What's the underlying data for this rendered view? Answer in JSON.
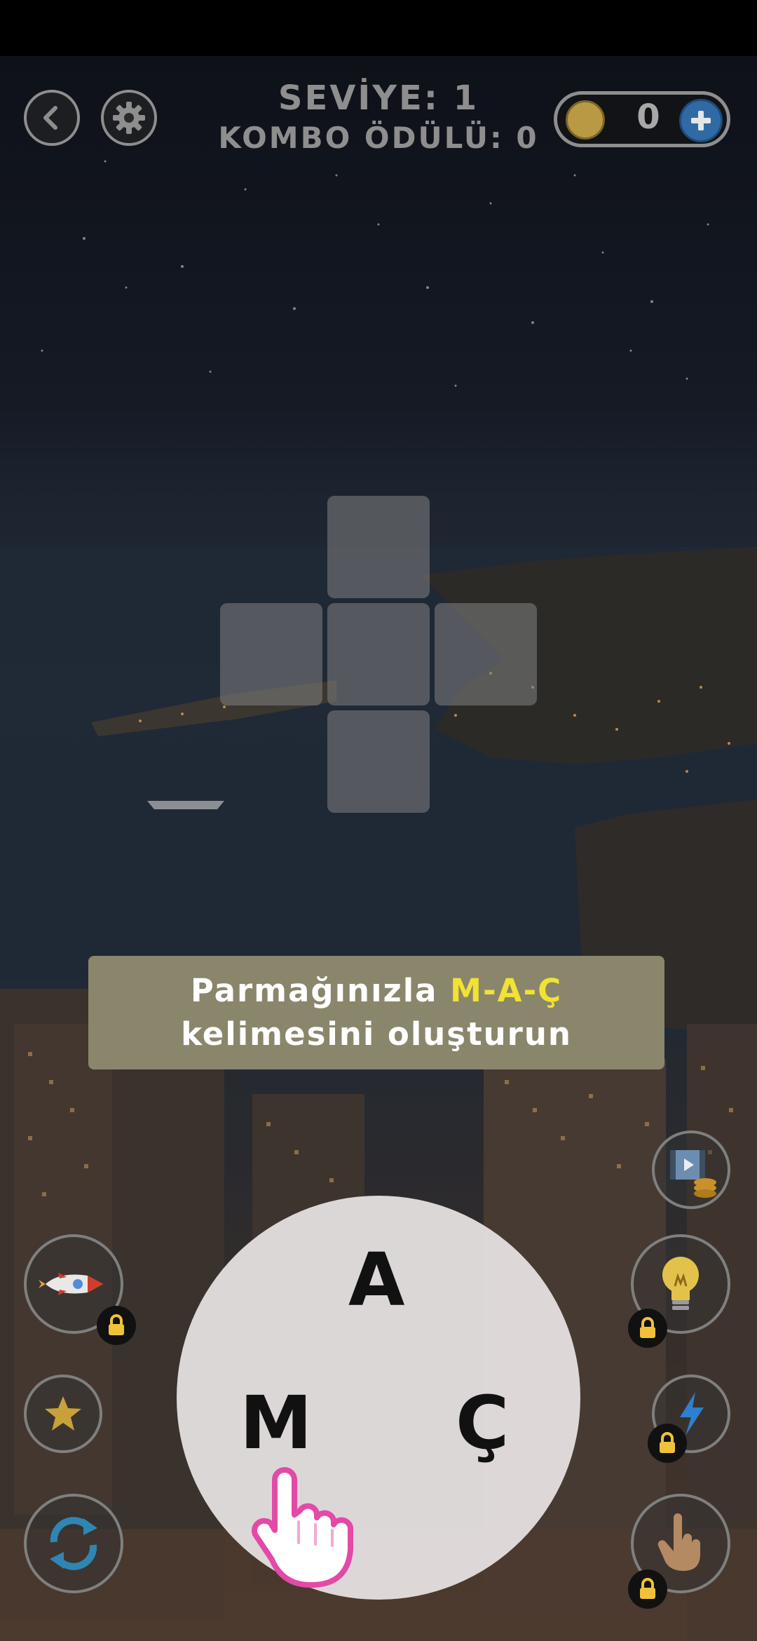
{
  "header": {
    "level_text": "SEVİYE: 1",
    "combo_text": "KOMBO ÖDÜLÜ: 0",
    "coin_count": "0"
  },
  "hint": {
    "prefix": "Parmağınızla",
    "word": "M-A-Ç",
    "line2": "kelimesini oluşturun"
  },
  "wheel": {
    "letters": [
      "A",
      "M",
      "Ç"
    ]
  },
  "grid": {
    "filled_cells": 0,
    "total_cells": 5
  },
  "colors": {
    "hint_background": "#8a866c",
    "hint_highlight": "#f2e232",
    "coin_gold": "#b99a44",
    "plus_blue": "#2f6aa5"
  },
  "icons": {
    "back": "back-arrow-icon",
    "settings": "gear-icon",
    "coin": "coin-icon",
    "plus": "plus-icon",
    "video_reward": "video-coins-icon",
    "rocket": "rocket-icon",
    "hint_bulb": "lightbulb-icon",
    "star": "star-icon",
    "lightning": "lightning-icon",
    "shuffle": "shuffle-icon",
    "finger_hint": "finger-icon",
    "tutorial_hand": "hand-pointer-icon",
    "lock": "lock-icon"
  }
}
